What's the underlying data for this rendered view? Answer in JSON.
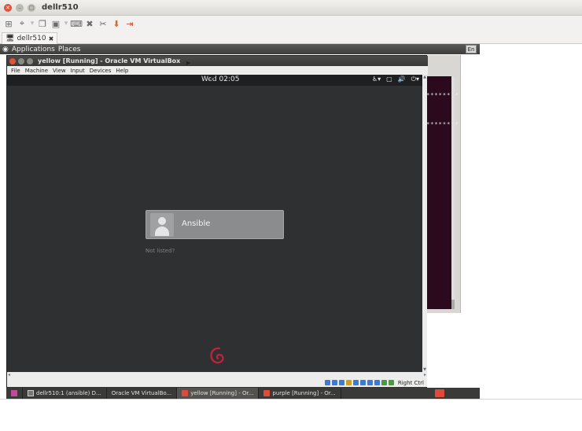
{
  "outer_window": {
    "title": "dellr510",
    "tab_label": "dellr510"
  },
  "remote_panel": {
    "applications": "Applications",
    "places": "Places",
    "language": "En"
  },
  "vbox_window": {
    "title": "yellow [Running] - Oracle VM VirtualBox",
    "menu": [
      "File",
      "Machine",
      "View",
      "Input",
      "Devices",
      "Help"
    ],
    "host_key_label": "Right Ctrl"
  },
  "guest": {
    "clock": "Wed 02:05",
    "user_name": "Ansible",
    "not_listed": "Not listed?"
  },
  "background_terminal": {
    "lines": [
      "********",
      "********"
    ]
  },
  "taskbar": {
    "items": [
      {
        "label": "dellr510:1 (ansible) D...",
        "icon": "terminal-icon"
      },
      {
        "label": "Oracle VM VirtualBo...",
        "icon": "virtualbox-icon"
      },
      {
        "label": "yellow [Running] - Or...",
        "icon": "vm-icon"
      },
      {
        "label": "purple [Running] - Or...",
        "icon": "vm-icon"
      }
    ]
  },
  "colors": {
    "guest_bg": "#2e3032",
    "accent_red": "#e04a3a",
    "terminal_bg": "#2c0a1e"
  }
}
